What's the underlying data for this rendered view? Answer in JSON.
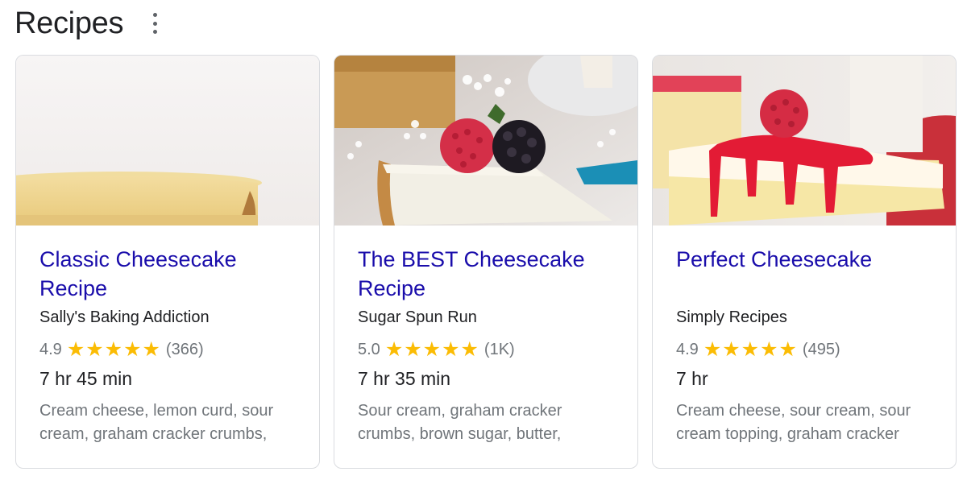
{
  "header": {
    "title": "Recipes",
    "menu_icon": "more-vert-icon"
  },
  "cards": [
    {
      "title": "Classic Cheesecake Recipe",
      "source": "Sally's Baking Addiction",
      "rating": "4.9",
      "rating_value": 4.9,
      "reviews": "(366)",
      "time": "7 hr 45 min",
      "ingredients": "Cream cheese, lemon curd, sour cream, graham cracker crumbs,"
    },
    {
      "title": "The BEST Cheesecake Recipe",
      "source": "Sugar Spun Run",
      "rating": "5.0",
      "rating_value": 5.0,
      "reviews": "(1K)",
      "time": "7 hr 35 min",
      "ingredients": "Sour cream, graham cracker crumbs, brown sugar, butter,"
    },
    {
      "title": "Perfect Cheesecake",
      "source": "Simply Recipes",
      "rating": "4.9",
      "rating_value": 4.9,
      "reviews": "(495)",
      "time": "7 hr",
      "ingredients": "Cream cheese, sour cream, sour cream topping, graham cracker"
    }
  ],
  "colors": {
    "link": "#1a0dab",
    "star": "#fbbc04",
    "muted": "#70757a",
    "text": "#202124"
  }
}
